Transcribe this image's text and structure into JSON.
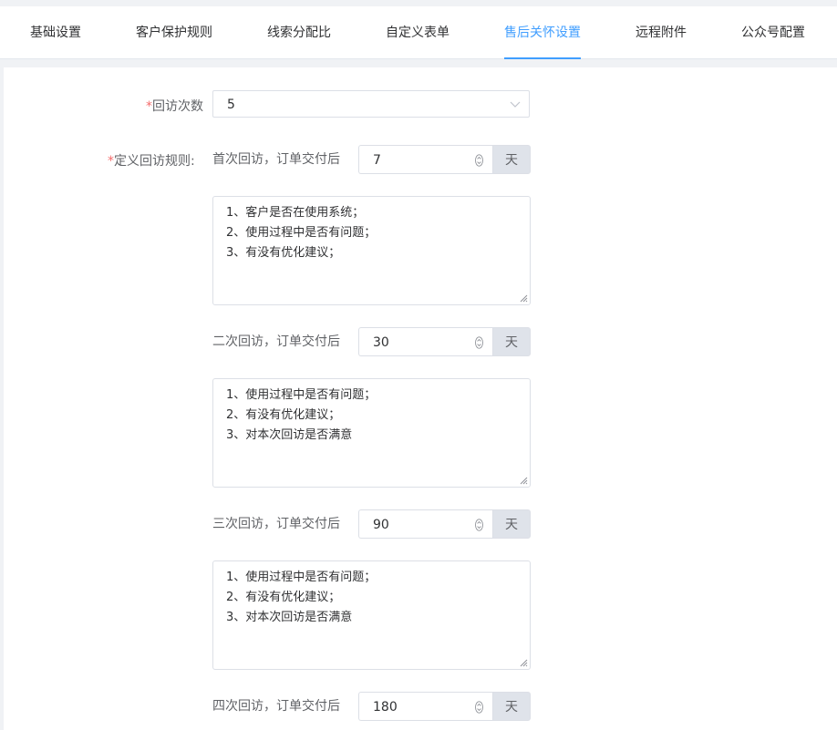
{
  "tabs": [
    {
      "label": "基础设置",
      "active": false
    },
    {
      "label": "客户保护规则",
      "active": false
    },
    {
      "label": "线索分配比",
      "active": false
    },
    {
      "label": "自定义表单",
      "active": false
    },
    {
      "label": "售后关怀设置",
      "active": true
    },
    {
      "label": "远程附件",
      "active": false
    },
    {
      "label": "公众号配置",
      "active": false
    }
  ],
  "form": {
    "visit_count": {
      "required_mark": "*",
      "label": "回访次数",
      "value": "5"
    },
    "rules": {
      "required_mark": "*",
      "label": "定义回访规则:"
    },
    "unit": "天",
    "visits": [
      {
        "label": "首次回访，订单交付后",
        "days": "7",
        "notes": [
          "1、客户是否在使用系统；",
          "2、使用过程中是否有问题；",
          "3、有没有优化建议；"
        ]
      },
      {
        "label": "二次回访，订单交付后",
        "days": "30",
        "notes": [
          "1、使用过程中是否有问题；",
          "2、有没有优化建议；",
          "3、对本次回访是否满意"
        ]
      },
      {
        "label": "三次回访，订单交付后",
        "days": "90",
        "notes": [
          "1、使用过程中是否有问题；",
          "2、有没有优化建议；",
          "3、对本次回访是否满意"
        ]
      },
      {
        "label": "四次回访，订单交付后",
        "days": "180"
      }
    ]
  },
  "colors": {
    "accent": "#409eff",
    "required": "#f56c6c",
    "border": "#dcdfe6",
    "unit_bg": "#dfe3ea"
  }
}
